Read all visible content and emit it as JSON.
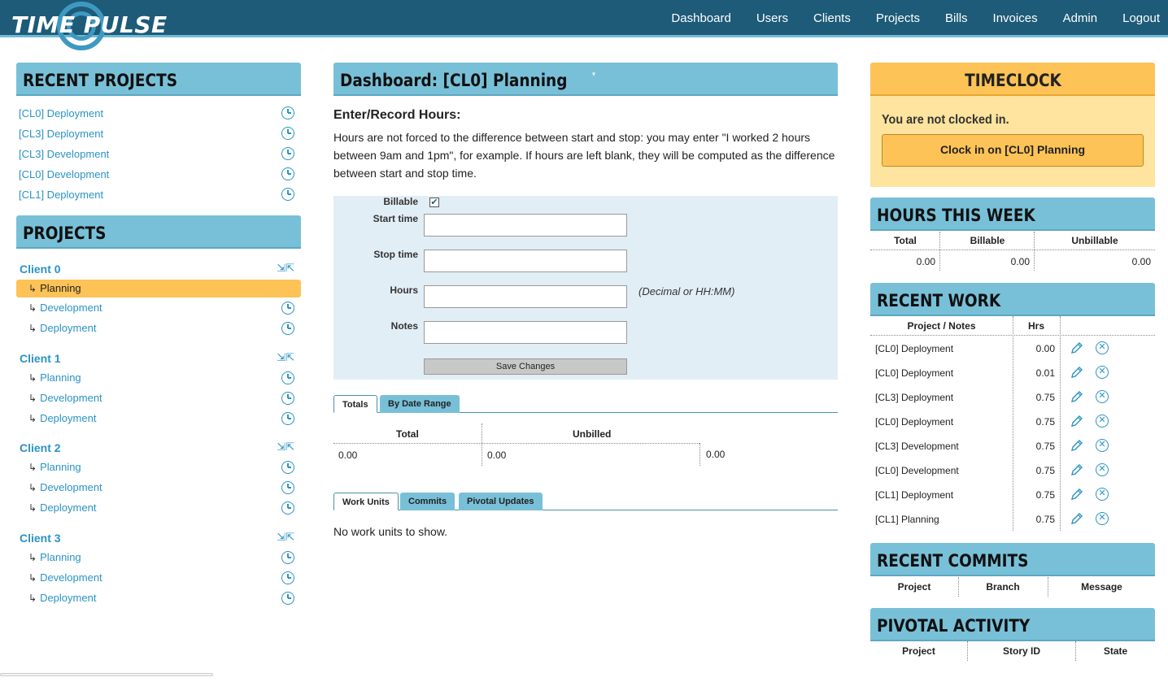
{
  "app": {
    "logo": "TIME PULSE"
  },
  "nav": [
    "Dashboard",
    "Users",
    "Clients",
    "Projects",
    "Bills",
    "Invoices",
    "Admin",
    "Logout"
  ],
  "recent_projects": {
    "title": "RECENT PROJECTS",
    "items": [
      "[CL0] Deployment",
      "[CL3] Deployment",
      "[CL3] Development",
      "[CL0] Development",
      "[CL1] Deployment"
    ]
  },
  "projects": {
    "title": "PROJECTS",
    "clients": [
      {
        "name": "Client 0",
        "items": [
          "Planning",
          "Development",
          "Deployment"
        ]
      },
      {
        "name": "Client 1",
        "items": [
          "Planning",
          "Development",
          "Deployment"
        ]
      },
      {
        "name": "Client 2",
        "items": [
          "Planning",
          "Development",
          "Deployment"
        ]
      },
      {
        "name": "Client 3",
        "items": [
          "Planning",
          "Development",
          "Deployment"
        ]
      }
    ]
  },
  "dashboard": {
    "title": "Dashboard: [CL0] Planning",
    "enter_title": "Enter/Record Hours:",
    "description": "Hours are not forced to the difference between start and stop: you may enter \"I worked 2 hours between 9am and 1pm\", for example. If hours are left blank, they will be computed as the difference between start and stop time.",
    "form": {
      "billable_label": "Billable",
      "billable_checked": true,
      "start_label": "Start time",
      "stop_label": "Stop time",
      "hours_label": "Hours",
      "notes_label": "Notes",
      "hours_hint": "(Decimal or HH:MM)",
      "save_label": "Save Changes"
    },
    "totals_tabs": [
      "Totals",
      "By Date Range"
    ],
    "totals": {
      "headers": [
        "Total",
        "Unbilled"
      ],
      "values": [
        "0.00",
        "0.00",
        "0.00"
      ]
    },
    "work_tabs": [
      "Work Units",
      "Commits",
      "Pivotal Updates"
    ],
    "no_work": "No work units to show."
  },
  "timeclock": {
    "title": "TIMECLOCK",
    "status": "You are not clocked in.",
    "button": "Clock in on [CL0] Planning"
  },
  "hours_week": {
    "title": "HOURS THIS WEEK",
    "headers": [
      "Total",
      "Billable",
      "Unbillable"
    ],
    "values": [
      "0.00",
      "0.00",
      "0.00"
    ]
  },
  "recent_work": {
    "title": "RECENT WORK",
    "headers": [
      "Project / Notes",
      "Hrs"
    ],
    "rows": [
      {
        "project": "[CL0] Deployment",
        "hrs": "0.00"
      },
      {
        "project": "[CL0] Deployment",
        "hrs": "0.01"
      },
      {
        "project": "[CL3] Deployment",
        "hrs": "0.75"
      },
      {
        "project": "[CL0] Deployment",
        "hrs": "0.75"
      },
      {
        "project": "[CL3] Development",
        "hrs": "0.75"
      },
      {
        "project": "[CL0] Development",
        "hrs": "0.75"
      },
      {
        "project": "[CL1] Deployment",
        "hrs": "0.75"
      },
      {
        "project": "[CL1] Planning",
        "hrs": "0.75"
      }
    ]
  },
  "recent_commits": {
    "title": "RECENT COMMITS",
    "headers": [
      "Project",
      "Branch",
      "Message"
    ]
  },
  "pivotal_activity": {
    "title": "PIVOTAL ACTIVITY",
    "headers": [
      "Project",
      "Story ID",
      "State"
    ]
  },
  "colors": {
    "nav": "#1d5b78",
    "header": "#78c0d8",
    "timeclock": "#fdc356",
    "link": "#2a93c4"
  }
}
